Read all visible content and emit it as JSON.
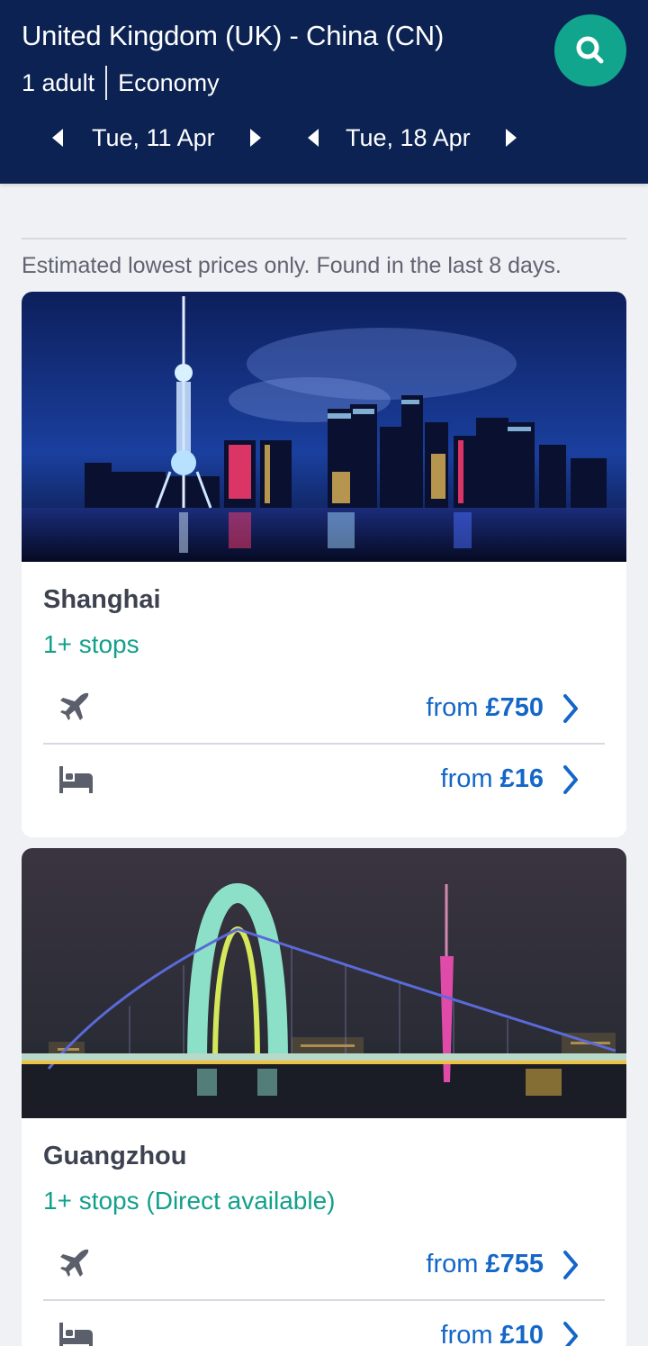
{
  "header": {
    "route": "United Kingdom (UK) - China (CN)",
    "passengers": "1 adult",
    "cabin": "Economy",
    "outbound_date": "Tue, 11 Apr",
    "return_date": "Tue, 18 Apr",
    "search_icon": "search-icon"
  },
  "notice": "Estimated lowest prices only. Found in the last 8 days.",
  "destinations": [
    {
      "city": "Shanghai",
      "stops": "1+ stops",
      "flight_prefix": "from ",
      "flight_price": "£750",
      "hotel_prefix": "from ",
      "hotel_price": "£16"
    },
    {
      "city": "Guangzhou",
      "stops": "1+ stops (Direct available)",
      "flight_prefix": "from ",
      "flight_price": "£755",
      "hotel_prefix": "from ",
      "hotel_price": "£10"
    }
  ],
  "colors": {
    "header_bg": "#0b2253",
    "accent_teal": "#13a08b",
    "price_blue": "#1467c7"
  }
}
